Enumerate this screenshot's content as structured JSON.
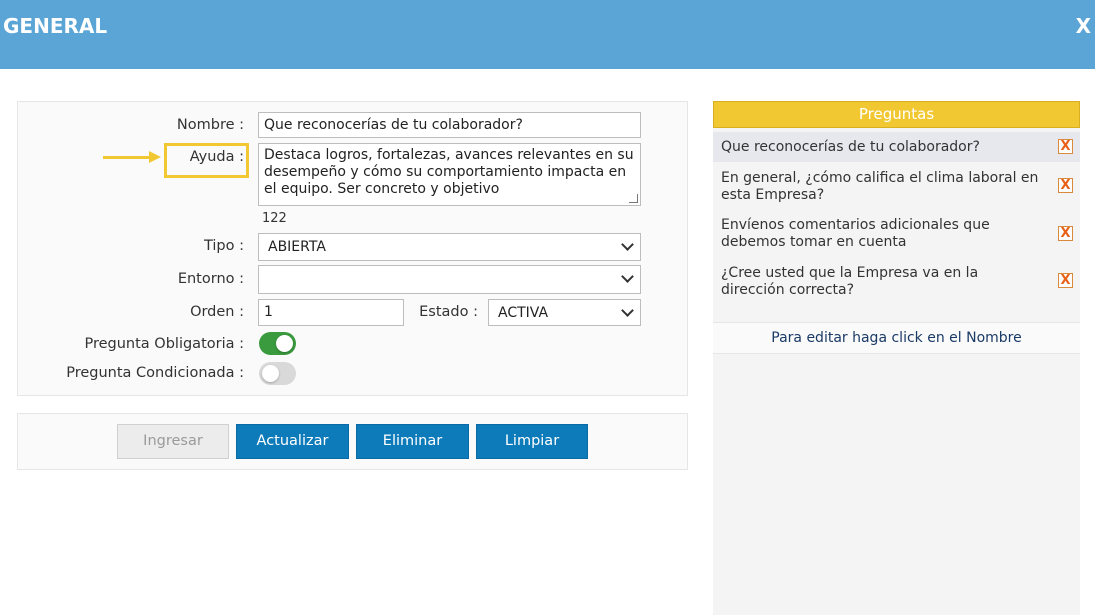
{
  "header": {
    "title": "GENERAL",
    "close_label": "X"
  },
  "form": {
    "nombre_label": "Nombre :",
    "nombre_value": "Que reconocerías de tu colaborador?",
    "ayuda_label": "Ayuda :",
    "ayuda_value": "Destaca logros, fortalezas, avances relevantes en su desempeño y cómo su comportamiento impacta en el equipo. Ser concreto y objetivo",
    "ayuda_count": "122",
    "tipo_label": "Tipo :",
    "tipo_value": "ABIERTA",
    "entorno_label": "Entorno :",
    "entorno_value": "",
    "orden_label": "Orden :",
    "orden_value": "1",
    "estado_label": "Estado :",
    "estado_value": "ACTIVA",
    "obligatoria_label": "Pregunta Obligatoria :",
    "obligatoria_on": true,
    "condicionada_label": "Pregunta Condicionada :",
    "condicionada_on": false
  },
  "buttons": {
    "ingresar": "Ingresar",
    "actualizar": "Actualizar",
    "eliminar": "Eliminar",
    "limpiar": "Limpiar"
  },
  "preguntas": {
    "title": "Preguntas",
    "items": [
      {
        "text": "Que reconocerías de tu colaborador?",
        "selected": true
      },
      {
        "text": "En general, ¿cómo califica el clima laboral en esta Empresa?",
        "selected": false
      },
      {
        "text": "Envíenos comentarios adicionales que debemos tomar en cuenta",
        "selected": false
      },
      {
        "text": "¿Cree usted que la Empresa va en la dirección correcta?",
        "selected": false
      }
    ],
    "delete_glyph": "X",
    "edit_hint": "Para editar haga click en el Nombre"
  },
  "colors": {
    "header": "#5aa5d6",
    "accent_yellow": "#f2c832",
    "button_blue": "#0d7ab9",
    "toggle_on": "#3a9a3e",
    "selected_row": "#e6e8ee"
  }
}
